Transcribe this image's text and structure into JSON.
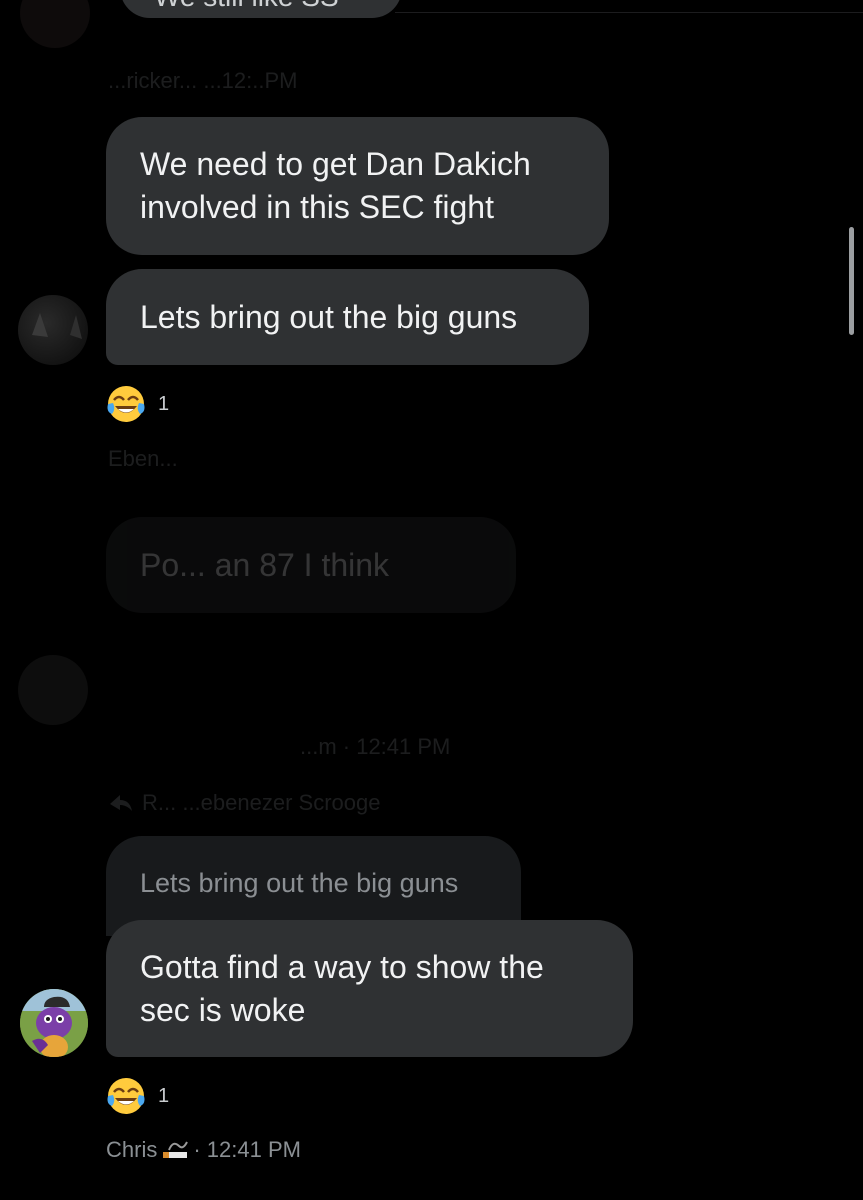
{
  "colors": {
    "background": "#000000",
    "bubble": "#2f3133",
    "quoted_bubble": "#181a1c",
    "meta_text": "#8b9094"
  },
  "messages": [
    {
      "text": "We need to get Dan Dakich involved in this SEC fight"
    },
    {
      "text": "Lets bring out the big guns",
      "reaction": {
        "icon": "tears-of-joy-emoji-icon",
        "count": "1"
      }
    },
    {
      "text": "Po... an 87 I think",
      "faded": true
    },
    {
      "text": "Gotta find a way to show the sec is woke",
      "quoted": "Lets bring out the big guns",
      "reaction": {
        "icon": "tears-of-joy-emoji-icon",
        "count": "1"
      },
      "sender": "Chris",
      "time": "· 12:41 PM"
    }
  ],
  "faded_meta": {
    "line1": "...ricker... ...12:..PM",
    "line2": "Eben...",
    "line3": "...m · 12:41 PM",
    "reply_line": "R... ...ebenezer Scrooge"
  }
}
